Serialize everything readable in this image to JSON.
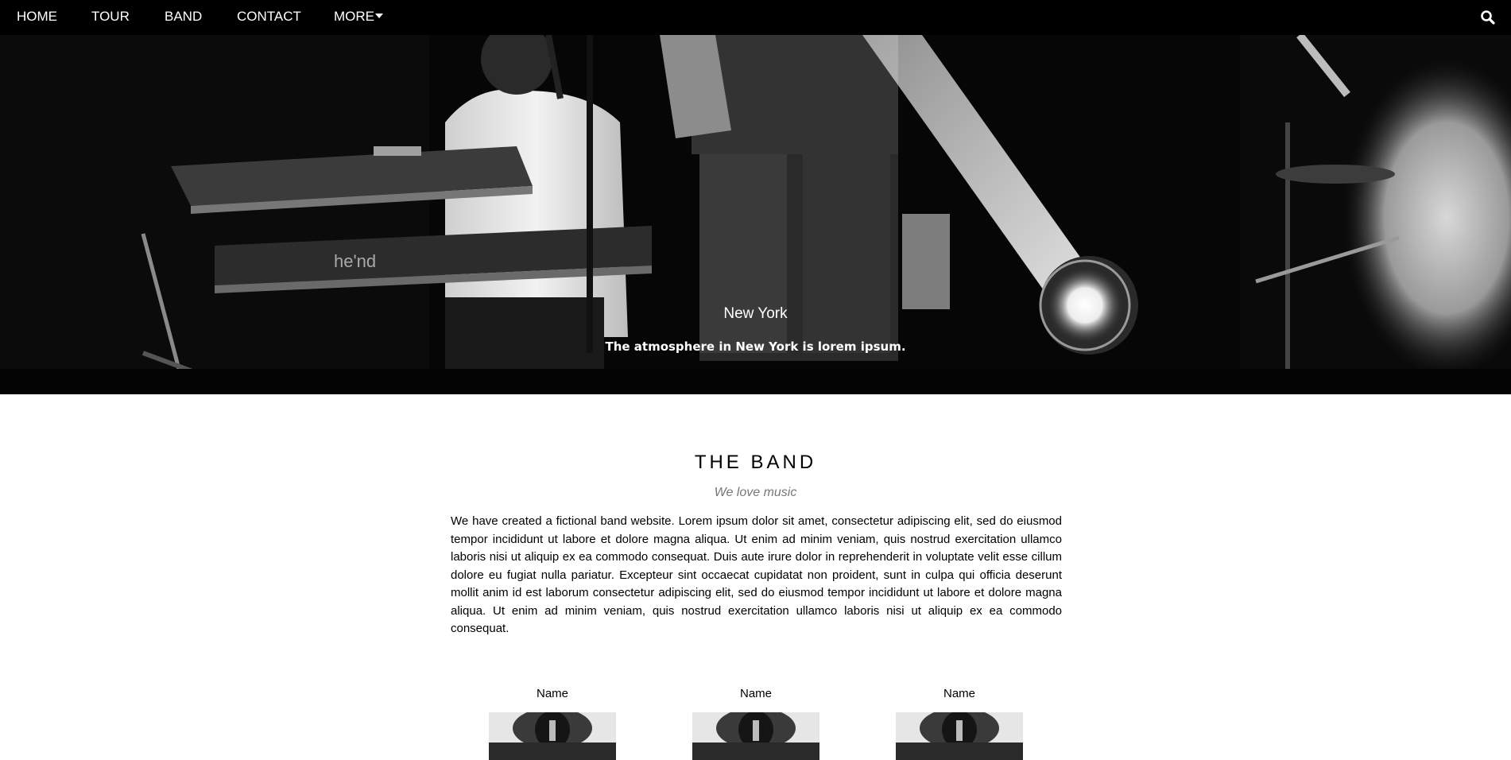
{
  "nav": {
    "home": "HOME",
    "tour": "TOUR",
    "band": "BAND",
    "contact": "CONTACT",
    "more": "MORE"
  },
  "icons": {
    "search": "search-icon",
    "more_dropdown": "caret-down-icon"
  },
  "hero": {
    "title": "New York",
    "text": "The atmosphere in New York is lorem ipsum."
  },
  "band": {
    "title": "THE BAND",
    "subtitle": "We love music",
    "description": "We have created a fictional band website. Lorem ipsum dolor sit amet, consectetur adipiscing elit, sed do eiusmod tempor incididunt ut labore et dolore magna aliqua. Ut enim ad minim veniam, quis nostrud exercitation ullamco laboris nisi ut aliquip ex ea commodo consequat. Duis aute irure dolor in reprehenderit in voluptate velit esse cillum dolore eu fugiat nulla pariatur. Excepteur sint occaecat cupidatat non proident, sunt in culpa qui officia deserunt mollit anim id est laborum consectetur adipiscing elit, sed do eiusmod tempor incididunt ut labore et dolore magna aliqua. Ut enim ad minim veniam, quis nostrud exercitation ullamco laboris nisi ut aliquip ex ea commodo consequat.",
    "members": [
      {
        "name": "Name"
      },
      {
        "name": "Name"
      },
      {
        "name": "Name"
      }
    ]
  },
  "colors": {
    "nav_bg": "#000000",
    "nav_text": "#ffffff",
    "subtitle": "#777777",
    "body_text": "#000000"
  }
}
